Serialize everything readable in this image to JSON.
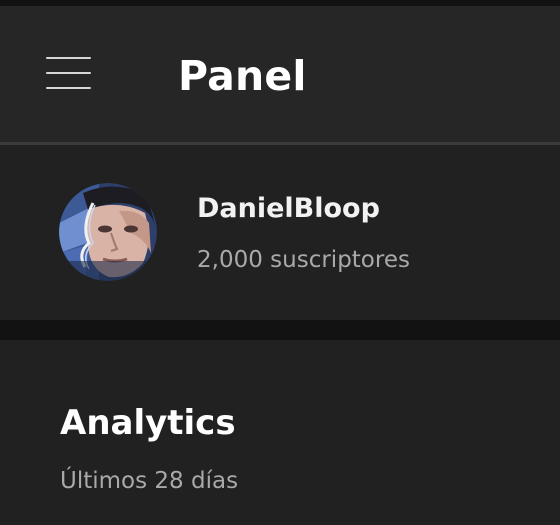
{
  "header": {
    "menu_icon": "hamburger-menu-icon",
    "title": "Panel"
  },
  "channel": {
    "name": "DanielBloop",
    "subscribers": "2,000 suscriptores"
  },
  "analytics": {
    "title": "Analytics",
    "period": "Últimos 28 días"
  },
  "colors": {
    "header_bg": "#262626",
    "card_bg": "#212121",
    "page_bg": "#121212",
    "primary_text": "#ffffff",
    "secondary_text": "#a9a9a9"
  }
}
